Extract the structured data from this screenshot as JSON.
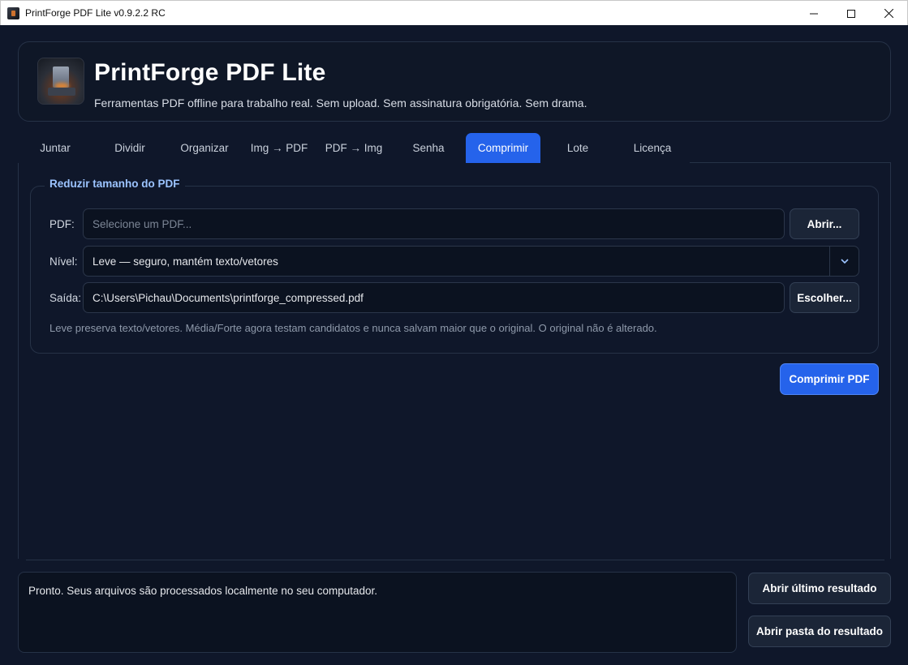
{
  "window": {
    "title": "PrintForge PDF Lite v0.9.2.2 RC"
  },
  "header": {
    "app_title": "PrintForge PDF Lite",
    "subtitle": "Ferramentas PDF offline para trabalho real. Sem upload. Sem assinatura obrigatória. Sem drama."
  },
  "tabs": [
    {
      "label": "Juntar",
      "active": false
    },
    {
      "label": "Dividir",
      "active": false
    },
    {
      "label": "Organizar",
      "active": false
    },
    {
      "label": "Img → PDF",
      "active": false
    },
    {
      "label": "PDF → Img",
      "active": false
    },
    {
      "label": "Senha",
      "active": false
    },
    {
      "label": "Comprimir",
      "active": true
    },
    {
      "label": "Lote",
      "active": false
    },
    {
      "label": "Licença",
      "active": false
    }
  ],
  "compress": {
    "group_title": "Reduzir tamanho do PDF",
    "pdf_label": "PDF:",
    "pdf_placeholder": "Selecione um PDF...",
    "pdf_value": "",
    "open_button": "Abrir...",
    "level_label": "Nível:",
    "level_value": "Leve — seguro, mantém texto/vetores",
    "output_label": "Saída:",
    "output_value": "C:\\Users\\Pichau\\Documents\\printforge_compressed.pdf",
    "choose_button": "Escolher...",
    "hint": "Leve preserva texto/vetores. Média/Forte agora testam candidatos e nunca salvam maior que o original. O original não é alterado.",
    "compress_button": "Comprimir PDF"
  },
  "status": {
    "text": "Pronto. Seus arquivos são processados localmente no seu computador.",
    "open_last_button": "Abrir último resultado",
    "open_folder_button": "Abrir pasta do resultado"
  },
  "colors": {
    "background": "#0f172a",
    "accent": "#2563eb",
    "group_title": "#9cc4ff"
  }
}
